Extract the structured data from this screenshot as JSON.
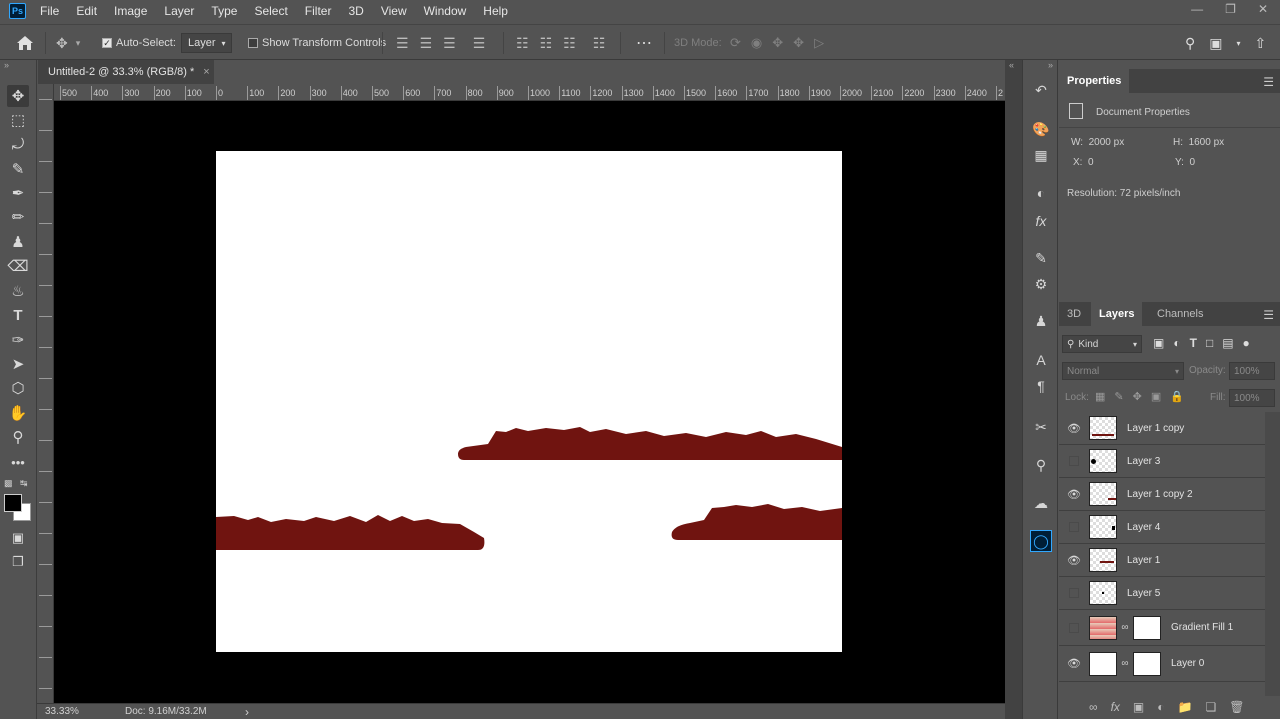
{
  "menu": [
    "File",
    "Edit",
    "Image",
    "Layer",
    "Type",
    "Select",
    "Filter",
    "3D",
    "View",
    "Window",
    "Help"
  ],
  "app_logo": "Ps",
  "options": {
    "auto_select_label": "Auto-Select:",
    "auto_select_value": "Layer",
    "show_transform_label": "Show Transform Controls",
    "mode_3d": "3D Mode:"
  },
  "doc_tab": {
    "title": "Untitled-2 @ 33.3% (RGB/8) *",
    "close": "×"
  },
  "ruler_h": [
    "500",
    "400",
    "300",
    "200",
    "100",
    "0",
    "100",
    "200",
    "300",
    "400",
    "500",
    "600",
    "700",
    "800",
    "900",
    "1000",
    "1100",
    "1200",
    "1300",
    "1400",
    "1500",
    "1600",
    "1700",
    "1800",
    "1900",
    "2000",
    "2100",
    "2200",
    "2300",
    "2400",
    "2"
  ],
  "status": {
    "zoom": "33.33%",
    "doc": "Doc: 9.16M/33.2M",
    "arrow": "›"
  },
  "properties": {
    "tab": "Properties",
    "section": "Document Properties",
    "w_label": "W:",
    "w_value": "2000 px",
    "h_label": "H:",
    "h_value": "1600 px",
    "x_label": "X:",
    "x_value": "0",
    "y_label": "Y:",
    "y_value": "0",
    "resolution": "Resolution: 72 pixels/inch"
  },
  "layers_panel": {
    "tabs": [
      "3D",
      "Layers",
      "Channels"
    ],
    "filter_label": "Kind",
    "blend_mode": "Normal",
    "opacity_label": "Opacity:",
    "opacity_value": "100%",
    "lock_label": "Lock:",
    "fill_label": "Fill:",
    "fill_value": "100%",
    "layers": [
      {
        "name": "Layer 1 copy",
        "visible": true
      },
      {
        "name": "Layer 3",
        "visible": false
      },
      {
        "name": "Layer 1 copy 2",
        "visible": true
      },
      {
        "name": "Layer 4",
        "visible": false
      },
      {
        "name": "Layer 1",
        "visible": true
      },
      {
        "name": "Layer 5",
        "visible": false
      },
      {
        "name": "Gradient Fill 1",
        "visible": false
      },
      {
        "name": "Layer 0",
        "visible": true
      }
    ]
  },
  "colors": {
    "ground": "#701410",
    "panel": "#535353",
    "dark": "#424242",
    "accent": "#31a8ff"
  }
}
